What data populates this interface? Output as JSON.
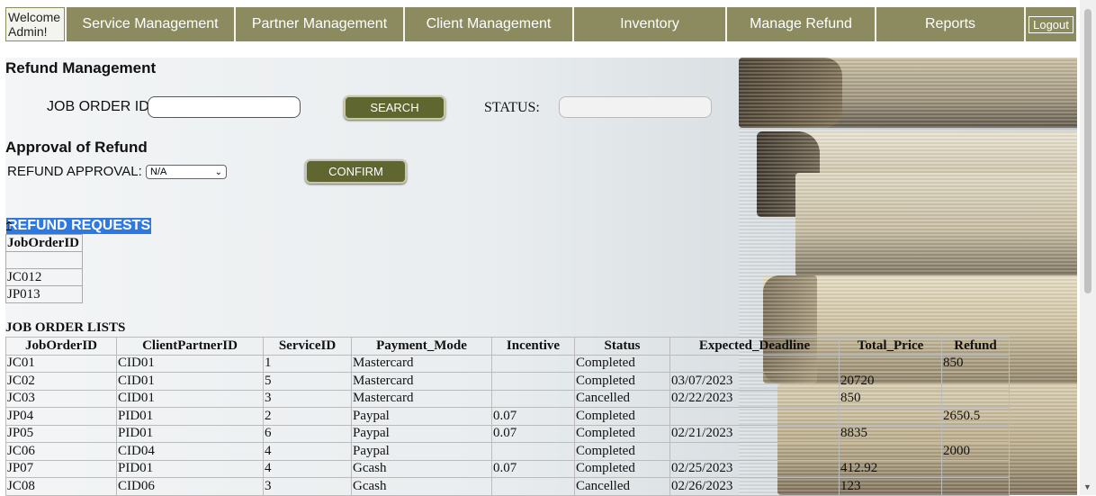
{
  "nav": {
    "welcome": "Welcome Admin!",
    "items": [
      "Service Management",
      "Partner Management",
      "Client Management",
      "Inventory",
      "Manage Refund",
      "Reports"
    ],
    "logout": "Logout"
  },
  "refund_management": {
    "title": "Refund Management",
    "job_order_label": "JOB ORDER ID:",
    "job_order_value": "",
    "search_button": "SEARCH",
    "status_label": "STATUS:",
    "status_value": ""
  },
  "approval": {
    "title": "Approval of Refund",
    "label": "REFUND APPROVAL:",
    "selected": "N/A",
    "confirm_button": "CONFIRM"
  },
  "refund_requests": {
    "title": "REFUND REQUESTS",
    "header": "JobOrderID",
    "rows": [
      "",
      "JC012",
      "JP013"
    ]
  },
  "job_order_lists": {
    "title": "JOB ORDER LISTS",
    "columns": [
      "JobOrderID",
      "ClientPartnerID",
      "ServiceID",
      "Payment_Mode",
      "Incentive",
      "Status",
      "Expected_Deadline",
      "Total_Price",
      "Refund"
    ],
    "rows": [
      [
        "JC01",
        "CID01",
        "1",
        "Mastercard",
        "",
        "Completed",
        "",
        "",
        "850"
      ],
      [
        "JC02",
        "CID01",
        "5",
        "Mastercard",
        "",
        "Completed",
        "03/07/2023",
        "20720",
        ""
      ],
      [
        "JC03",
        "CID01",
        "3",
        "Mastercard",
        "",
        "Cancelled",
        "02/22/2023",
        "850",
        ""
      ],
      [
        "JP04",
        "PID01",
        "2",
        "Paypal",
        "0.07",
        "Completed",
        "",
        "",
        "2650.5"
      ],
      [
        "JP05",
        "PID01",
        "6",
        "Paypal",
        "0.07",
        "Completed",
        "02/21/2023",
        "8835",
        ""
      ],
      [
        "JC06",
        "CID04",
        "4",
        "Paypal",
        "",
        "Completed",
        "",
        "",
        "2000"
      ],
      [
        "JP07",
        "PID01",
        "4",
        "Gcash",
        "0.07",
        "Completed",
        "02/25/2023",
        "412.92",
        ""
      ],
      [
        "JC08",
        "CID06",
        "3",
        "Gcash",
        "",
        "Cancelled",
        "02/26/2023",
        "123",
        ""
      ]
    ]
  },
  "colors": {
    "nav_olive": "#8b8b5f",
    "button_olive": "#5f6630",
    "selection_blue": "#2f78e0"
  }
}
